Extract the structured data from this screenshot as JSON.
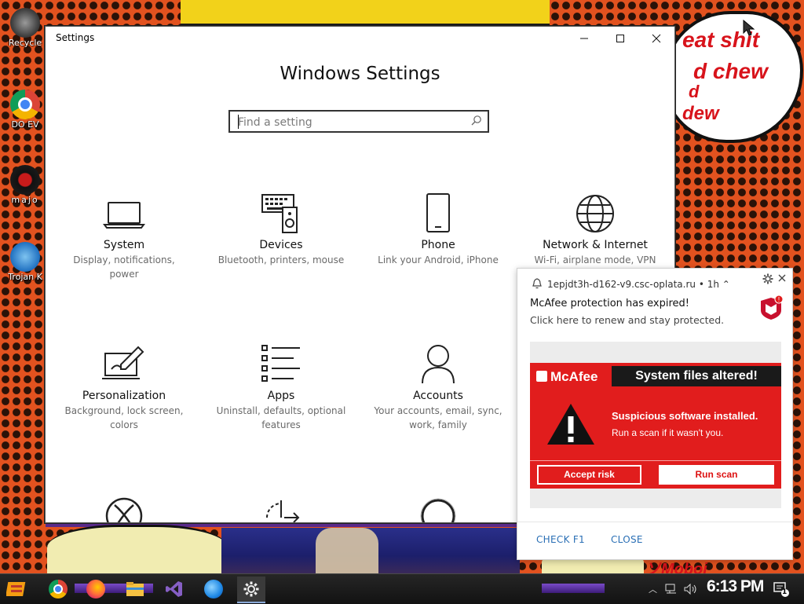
{
  "desktop": {
    "icons": [
      {
        "label": "Recycle",
        "icon": "recycle-bin-icon"
      },
      {
        "label": "DO EV",
        "icon": "chrome-icon"
      },
      {
        "label": "majo",
        "icon": "disc-icon"
      },
      {
        "label": "Trojan K",
        "icon": "trojan-icon"
      }
    ],
    "wallpaper_text": {
      "bubble_lines": [
        "eat shit",
        "d chew",
        "d",
        "dew"
      ],
      "bottom_right": "ソMoboi"
    }
  },
  "settings_window": {
    "title": "Settings",
    "heading": "Windows Settings",
    "search_placeholder": "Find a setting",
    "tiles": [
      {
        "name": "System",
        "desc": "Display, notifications, power",
        "icon": "laptop-icon"
      },
      {
        "name": "Devices",
        "desc": "Bluetooth, printers, mouse",
        "icon": "keyboard-speaker-icon"
      },
      {
        "name": "Phone",
        "desc": "Link your Android, iPhone",
        "icon": "phone-icon"
      },
      {
        "name": "Network & Internet",
        "desc": "Wi-Fi, airplane mode, VPN",
        "icon": "globe-icon"
      },
      {
        "name": "Personalization",
        "desc": "Background, lock screen, colors",
        "icon": "paint-icon"
      },
      {
        "name": "Apps",
        "desc": "Uninstall, defaults, optional features",
        "icon": "apps-list-icon"
      },
      {
        "name": "Accounts",
        "desc": "Your accounts, email, sync, work, family",
        "icon": "person-icon"
      }
    ],
    "partial_icons": [
      "xbox-icon",
      "time-language-icon",
      "ease-of-access-icon"
    ]
  },
  "notification": {
    "source": "1epjdt3h-d162-v9.csc-oplata.ru",
    "time": "1h",
    "heading": "McAfee protection has expired!",
    "subtext": "Click here to renew and stay protected.",
    "promo": {
      "logo_text": "McAfee",
      "alert_title": "System files altered!",
      "suspicious": "Suspicious software installed.",
      "run_message": "Run a scan if it wasn't you.",
      "accept_label": "Accept risk",
      "scan_label": "Run scan"
    },
    "actions": [
      "CHECK F1",
      "CLOSE"
    ],
    "colors": {
      "brand_red": "#e11d1d",
      "link_blue": "#2a6fb5"
    }
  },
  "taskbar": {
    "apps": [
      "game-launcher-icon",
      "chrome-icon",
      "firefox-icon",
      "file-explorer-icon",
      "visual-studio-icon",
      "ie-globe-icon",
      "settings-gear-icon"
    ],
    "active_app": "settings-gear-icon",
    "clock": "6:13 PM",
    "notification_count": "1"
  }
}
